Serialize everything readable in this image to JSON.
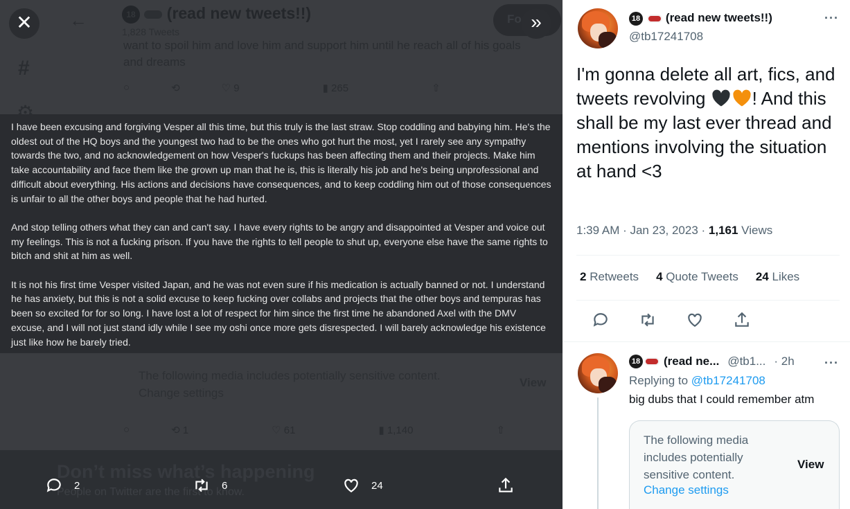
{
  "viewer": {
    "close_icon": "close-icon",
    "expand_icon": "double-chevron-right-icon",
    "background": {
      "profile_name": "(read new tweets!!)",
      "badge": "18",
      "tweet_count": "1,828 Tweets",
      "follow_label": "Fo",
      "tweet_text": "want to spoil him and love him and support him until he reach all of his goals and dreams",
      "row1_likes": "9",
      "row1_views": "265",
      "sensitive_text": "The following media includes potentially sensitive content.",
      "change_settings": "Change settings",
      "view_label": "View",
      "row2_retweets": "1",
      "row2_likes": "61",
      "row2_views": "1,140",
      "banner_title": "Don’t miss what’s happening",
      "banner_sub": "People on Twitter are the first to know."
    },
    "image_paragraphs": [
      "I have been excusing and forgiving Vesper all this time, but this truly is the last straw. Stop coddling and babying him. He's the oldest out of the HQ boys and the youngest two had to be the ones who got hurt the most, yet I rarely see any sympathy towards the two, and no acknowledgement on how Vesper's fuckups has been affecting them and their projects. Make him take accountability and face them like the grown up man that he is, this is literally his job and he's being unprofessional and difficult about everything. His actions and decisions have consequences, and to keep coddling him out of those consequences is unfair to all the other boys and people that he had hurted.",
      "And stop telling others what they can and can't say. I have every rights to be angry and disappointed at Vesper and voice out my feelings. This is not a fucking prison. If you have the rights to tell people to shut up, everyone else have the same rights to bitch and shit at him as well.",
      "It is not his first time Vesper visited Japan, and he was not even sure if his medication is actually banned or not. I understand he has anxiety, but this is not a solid excuse to keep fucking over collabs and projects that the other boys and tempuras has been so excited for for so long. I have lost a lot of respect for him since the first time he abandoned Axel with the DMV excuse, and I will not just stand idly while I see my oshi once more gets disrespected. I will barely acknowledge his existence just like how he barely tried."
    ],
    "actions": {
      "replies": "2",
      "retweets": "6",
      "likes": "24"
    }
  },
  "tweet": {
    "badge": "18",
    "display_name": "(read new tweets!!)",
    "handle": "@tb17241708",
    "more_label": "···",
    "text_part1": "I'm gonna delete all art, fics, and tweets revolving ",
    "text_part2": "! And this shall be my last ever thread and mentions involving the situation at hand <3",
    "heart_colors": [
      "#292f33",
      "#f4900c"
    ],
    "timestamp": "1:39 AM · Jan 23, 2023 · ",
    "views_count": "1,161",
    "views_label": " Views",
    "retweets_count": "2",
    "retweets_label": " Retweets",
    "quotes_count": "4",
    "quotes_label": " Quote Tweets",
    "likes_count": "24",
    "likes_label": " Likes"
  },
  "reply": {
    "badge": "18",
    "display_name": "(read ne...",
    "handle": "@tb1...",
    "time": "· 2h",
    "more_label": "···",
    "replying_prefix": "Replying to ",
    "replying_handle": "@tb17241708",
    "text": "big dubs that I could remember atm",
    "sensitive_text": "The following media includes potentially sensitive content.",
    "change_settings": "Change settings",
    "view_label": "View"
  }
}
